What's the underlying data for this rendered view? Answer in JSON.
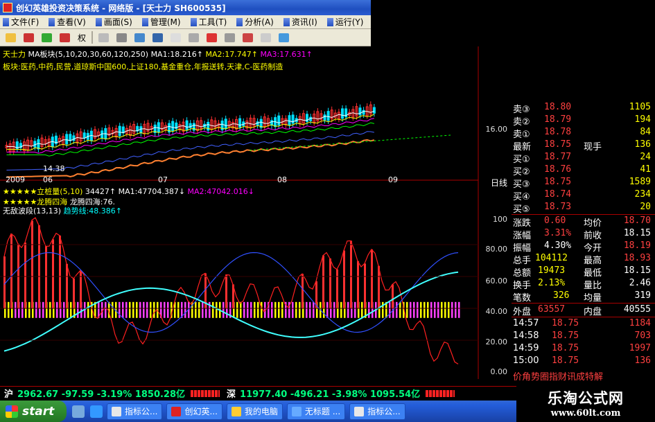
{
  "window": {
    "title": "创幻英雄投资决策系统 - 网络版 - [天士力 SH600535]"
  },
  "menu": [
    {
      "label": "文件(F)"
    },
    {
      "label": "查看(V)"
    },
    {
      "label": "画面(S)"
    },
    {
      "label": "管理(M)"
    },
    {
      "label": "工具(T)"
    },
    {
      "label": "分析(A)"
    },
    {
      "label": "资讯(I)"
    },
    {
      "label": "运行(Y)"
    }
  ],
  "toolbar": {
    "rights_label": "权"
  },
  "price_info": {
    "stock": "天士力",
    "ma_name": "MA板块(5,10,20,30,60,120,250)",
    "ma1": "MA1:18.216↑",
    "ma2": "MA2:17.747↑",
    "ma3": "MA3:17.631↑"
  },
  "sector_info": "板块:医药,中药,民营,道琼斯中国600,上证180,基金重仓,年报送转,天津,C-医药制造",
  "axis": {
    "price_label": "16.00",
    "low_label": "14.38",
    "years": [
      "2009",
      "06",
      "07",
      "08",
      "09"
    ],
    "period": "日线",
    "ind_ticks": [
      "100",
      "80.00",
      "60.00",
      "40.00",
      "20.00",
      "0.00"
    ]
  },
  "indicators": {
    "line1_name": "★★★★★立桩量(5,10)",
    "line1_val": "34427↑",
    "line1_ma1": "MA1:47704.387↓",
    "line1_ma2": "MA2:47042.016↓",
    "line2_name": "★★★★★龙腾四海",
    "line2_val": "龙腾四海:76.",
    "line3_name": "无敌波段(13,13)",
    "line3_val": "趋势线:48.386↑"
  },
  "quote": {
    "asks": [
      {
        "label": "卖③",
        "price": "18.80",
        "vol": "1105"
      },
      {
        "label": "卖②",
        "price": "18.79",
        "vol": "194"
      },
      {
        "label": "卖①",
        "price": "18.78",
        "vol": "84"
      }
    ],
    "last": {
      "label": "最新",
      "price": "18.75",
      "label2": "现手",
      "vol": "136"
    },
    "bids": [
      {
        "label": "买①",
        "price": "18.77",
        "vol": "24"
      },
      {
        "label": "买②",
        "price": "18.76",
        "vol": "41"
      },
      {
        "label": "买③",
        "price": "18.75",
        "vol": "1589"
      },
      {
        "label": "买④",
        "price": "18.74",
        "vol": "234"
      },
      {
        "label": "买⑤",
        "price": "18.73",
        "vol": "20"
      }
    ],
    "stats": [
      {
        "l1": "涨跌",
        "v1": "0.60",
        "l2": "均价",
        "v2": "18.70"
      },
      {
        "l1": "涨幅",
        "v1": "3.31%",
        "l2": "前收",
        "v2": "18.15"
      },
      {
        "l1": "振幅",
        "v1": "4.30%",
        "l2": "今开",
        "v2": "18.19"
      },
      {
        "l1": "总手",
        "v1": "104112",
        "l2": "最高",
        "v2": "18.93"
      },
      {
        "l1": "总额",
        "v1": "19473",
        "l2": "最低",
        "v2": "18.15"
      },
      {
        "l1": "换手",
        "v1": "2.13%",
        "l2": "量比",
        "v2": "2.46"
      },
      {
        "l1": "笔数",
        "v1": "326",
        "l2": "均量",
        "v2": "319"
      }
    ],
    "outer": {
      "label": "外盘",
      "val": "63557",
      "label2": "内盘",
      "val2": "40555"
    },
    "ticks": [
      {
        "time": "14:57",
        "price": "18.75",
        "vol": "1184"
      },
      {
        "time": "14:58",
        "price": "18.75",
        "vol": "703"
      },
      {
        "time": "14:59",
        "price": "18.75",
        "vol": "1997"
      },
      {
        "time": "15:00",
        "price": "18.75",
        "vol": "136"
      }
    ],
    "marquee": "价角势圈指财讯成特解"
  },
  "index_bar": {
    "sh_name": "沪",
    "sh_val": "2962.67 -97.59 -3.19% 1850.28亿",
    "sz_name": "深",
    "sz_val": "11977.40 -496.21 -3.98% 1095.54亿"
  },
  "taskbar": {
    "start": "start",
    "tasks": [
      {
        "label": "指标公...",
        "color": "#e8e8e8"
      },
      {
        "label": "创幻英...",
        "color": "#d22"
      },
      {
        "label": "我的电脑",
        "color": "#fc3"
      },
      {
        "label": "无标题 ...",
        "color": "#6af"
      },
      {
        "label": "指标公...",
        "color": "#e8e8e8"
      }
    ]
  },
  "watermark": {
    "title": "乐淘公式网",
    "url": "www.60lt.com"
  },
  "colors": {
    "up": "#ff4040",
    "down": "#00ffff",
    "accent": "#ffff00"
  }
}
